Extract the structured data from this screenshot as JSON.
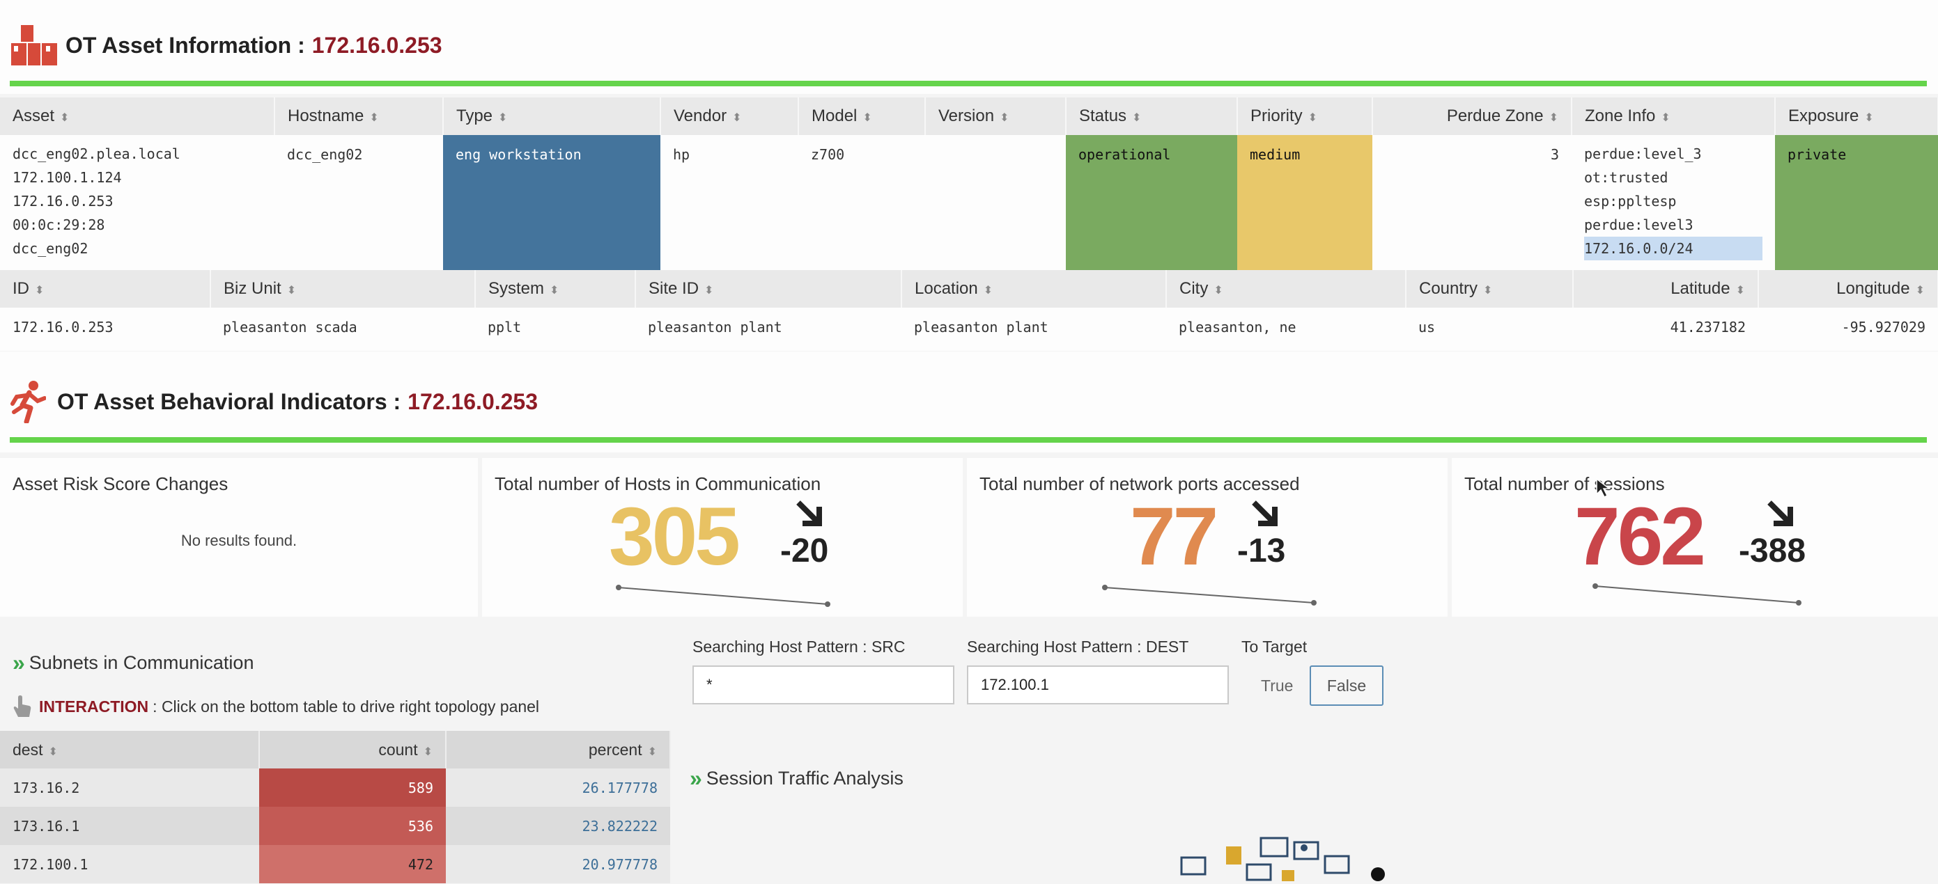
{
  "asset_info": {
    "title": "OT Asset Information :",
    "ip": "172.16.0.253",
    "icon": "factory-icon",
    "headers": [
      "Asset",
      "Hostname",
      "Type",
      "Vendor",
      "Model",
      "Version",
      "Status",
      "Priority",
      "Perdue Zone",
      "Zone Info",
      "Exposure"
    ],
    "row": {
      "asset": [
        "dcc_eng02.plea.local",
        "172.100.1.124",
        "172.16.0.253",
        "00:0c:29:28",
        "dcc_eng02"
      ],
      "hostname": "dcc_eng02",
      "type": "eng workstation",
      "vendor": "hp",
      "model": "z700",
      "version": "",
      "status": "operational",
      "priority": "medium",
      "perdue_zone": "3",
      "zone_info": [
        "perdue:level_3",
        "ot:trusted",
        "esp:ppltesp",
        "perdue:level3",
        "172.16.0.0/24"
      ],
      "exposure": "private"
    },
    "headers2": [
      "ID",
      "Biz Unit",
      "System",
      "Site ID",
      "Location",
      "City",
      "Country",
      "Latitude",
      "Longitude"
    ],
    "row2": {
      "id": "172.16.0.253",
      "biz_unit": "pleasanton scada",
      "system": "pplt",
      "site_id": "pleasanton plant",
      "location": "pleasanton plant",
      "city": "pleasanton, ne",
      "country": "us",
      "latitude": "41.237182",
      "longitude": "-95.927029"
    },
    "colors": {
      "type": "#44749c",
      "status": "#7aaa60",
      "priority": "#e8c86a",
      "exposure": "#7aaa60"
    }
  },
  "behavior": {
    "title": "OT Asset Behavioral Indicators :",
    "ip": "172.16.0.253",
    "icon": "running-person-icon",
    "risk_panel": {
      "title": "Asset Risk Score Changes",
      "empty": "No results found."
    },
    "kpis": [
      {
        "title": "Total number of Hosts in Communication",
        "value": "305",
        "delta": "-20",
        "color": "#e8c263",
        "trend": "down"
      },
      {
        "title": "Total number of network ports accessed",
        "value": "77",
        "delta": "-13",
        "color": "#e08a4f",
        "trend": "down"
      },
      {
        "title": "Total number of sessions",
        "value": "762",
        "delta": "-388",
        "color": "#c9454a",
        "trend": "down"
      }
    ]
  },
  "subnets": {
    "title": "Subnets in Communication",
    "interaction_label": "INTERACTION",
    "interaction_text": ": Click on the bottom table to drive right topology panel",
    "headers": [
      "dest",
      "count",
      "percent"
    ],
    "rows": [
      {
        "dest": "173.16.2",
        "count": "589",
        "percent": "26.177778",
        "color": "#b84a45"
      },
      {
        "dest": "173.16.1",
        "count": "536",
        "percent": "23.822222",
        "color": "#c35a55"
      },
      {
        "dest": "172.100.1",
        "count": "472",
        "percent": "20.977778",
        "color": "#cf706a"
      }
    ]
  },
  "search": {
    "src_label": "Searching Host Pattern : SRC",
    "src_value": "*",
    "dest_label": "Searching Host Pattern : DEST",
    "dest_value": "172.100.1",
    "target_label": "To Target",
    "target_true": "True",
    "target_false": "False"
  },
  "session": {
    "title": "Session Traffic Analysis"
  }
}
